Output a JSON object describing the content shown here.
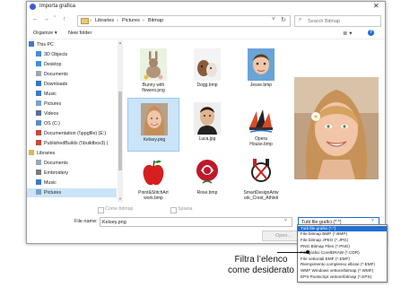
{
  "window": {
    "title": "Importa grafica",
    "close_glyph": "✕"
  },
  "address": {
    "back": "←",
    "forward": "→",
    "recent": "ˇ",
    "up": "↑",
    "crumbs": [
      "Libraries",
      "Pictures",
      "Bitmap"
    ],
    "separator": "›",
    "refresh": "↻",
    "dropdown": "˅",
    "search_placeholder": "Search Bitmap",
    "search_glyph": "⌕"
  },
  "toolbar": {
    "organize": "Organize ▾",
    "new_folder": "New folder",
    "view_glyph": "≣ ▾",
    "help_glyph": "?"
  },
  "nav": {
    "items": [
      {
        "label": "This PC",
        "icon": "computer-icon",
        "color": "#3b7bd4",
        "indent": 2
      },
      {
        "label": "3D Objects",
        "icon": "cube-icon",
        "color": "#4a8ad6",
        "indent": 10
      },
      {
        "label": "Desktop",
        "icon": "desktop-icon",
        "color": "#3d8fd8",
        "indent": 10
      },
      {
        "label": "Documents",
        "icon": "documents-icon",
        "color": "#9aa7b7",
        "indent": 10
      },
      {
        "label": "Downloads",
        "icon": "download-icon",
        "color": "#2f78c8",
        "indent": 10
      },
      {
        "label": "Music",
        "icon": "music-icon",
        "color": "#3a7ac8",
        "indent": 10
      },
      {
        "label": "Pictures",
        "icon": "pictures-icon",
        "color": "#7aa0c8",
        "indent": 10
      },
      {
        "label": "Videos",
        "icon": "videos-icon",
        "color": "#5a6c90",
        "indent": 10
      },
      {
        "label": "OS (C:)",
        "icon": "drive-icon",
        "color": "#5a8cc8",
        "indent": 10
      },
      {
        "label": "Documentation (\\\\ppgfile) (E:)",
        "icon": "network-drive-icon",
        "color": "#c8463a",
        "indent": 10
      },
      {
        "label": "PublishedBuilds (\\\\buildbox3) (",
        "icon": "network-drive-icon",
        "color": "#c8463a",
        "indent": 10
      },
      {
        "label": "Libraries",
        "icon": "libraries-icon",
        "color": "#e0b54c",
        "indent": 2
      },
      {
        "label": "Documents",
        "icon": "documents-icon",
        "color": "#9aa7b7",
        "indent": 10
      },
      {
        "label": "Embroidery",
        "icon": "library-icon",
        "color": "#7a7a7a",
        "indent": 10
      },
      {
        "label": "Music",
        "icon": "music-icon",
        "color": "#3a7ac8",
        "indent": 10
      },
      {
        "label": "Pictures",
        "icon": "pictures-icon",
        "color": "#7aa0c8",
        "indent": 10,
        "selected": true
      }
    ]
  },
  "files": [
    {
      "caption": "Bunny with\nflowers.png",
      "kind": "bunny",
      "selected": false
    },
    {
      "caption": "Dogg.bmp",
      "kind": "dogs",
      "selected": false
    },
    {
      "caption": "Jesse.bmp",
      "kind": "child",
      "selected": false
    },
    {
      "caption": "Kelsey.png",
      "kind": "woman",
      "selected": true
    },
    {
      "caption": "Luca.jpg",
      "kind": "man",
      "selected": false
    },
    {
      "caption": "Opera\nHouse.bmp",
      "kind": "opera",
      "selected": false
    },
    {
      "caption": "Point&StitchArt\nwork.bmp",
      "kind": "apple",
      "selected": false
    },
    {
      "caption": "Rose.bmp",
      "kind": "rose",
      "selected": false
    },
    {
      "caption": "SmartDesignArtw\nork_Crest_Athleti",
      "kind": "crest",
      "selected": false
    }
  ],
  "options": {
    "bitmap_label": "Come bitmap",
    "split_label": "Spiana"
  },
  "filename": {
    "label": "File name:",
    "value": "Kelsey.png",
    "dropdown": "˅"
  },
  "filetype": {
    "selected": "Tutti file grafici (*.*)",
    "dropdown": "˅",
    "options": [
      "Tutti file grafici (*.*)",
      "File bitmap BMP (*.BMP)",
      "File bitmap JPEG (*.JPG)",
      "PNG Bitmap Files (*.PNG)",
      "File grafici CorelDRAW (*.CDR)",
      "File vettoriali EMF (*.EMF)",
      "Riempimento complesso ellisse (*.EMF)",
      "WMF Windows vettore/bitmap (*.WMF)",
      "EPS Postscript vettore/bitmap (*.EPS)"
    ]
  },
  "open_button": "Open...",
  "callout": "Filtra l’elenco come desiderato",
  "colors": {
    "selection": "#cce4f7",
    "accent": "#1f6fd1"
  }
}
